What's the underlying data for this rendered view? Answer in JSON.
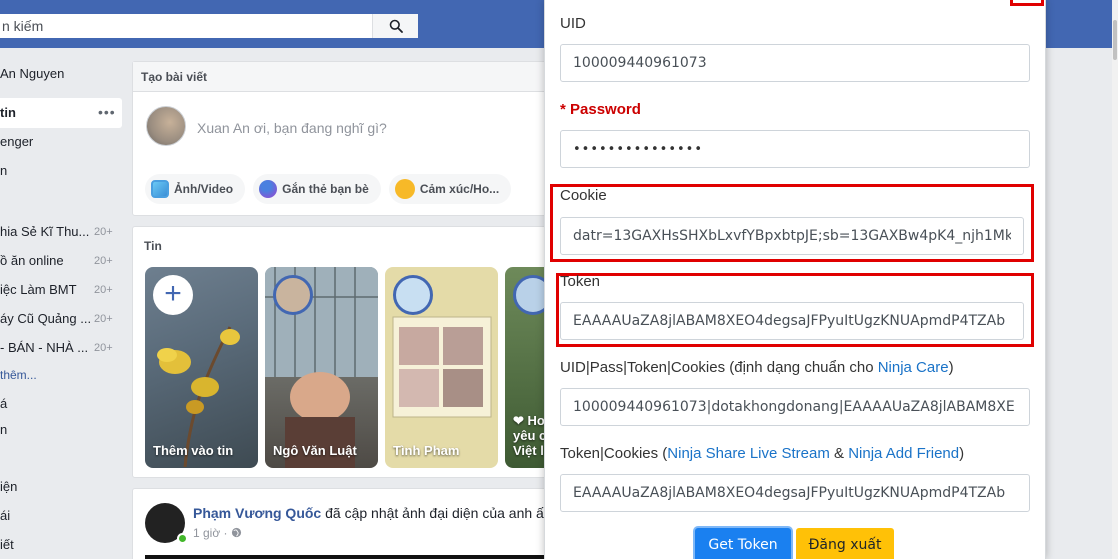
{
  "topbar": {
    "search_placeholder": "n kiếm",
    "search_icon": "search-icon"
  },
  "sidebar": {
    "profile": "An Nguyen",
    "items": [
      {
        "label": "tin",
        "top": 0
      },
      {
        "label": "enger"
      },
      {
        "label": "n"
      },
      {
        "label": "hia Sẻ Kĩ Thu...",
        "count": "20+"
      },
      {
        "label": "ồ ăn online",
        "count": "20+"
      },
      {
        "label": "iệc Làm BMT",
        "count": "20+"
      },
      {
        "label": "áy Cũ Quảng ...",
        "count": "20+"
      },
      {
        "label": "- BÁN - NHÀ ...",
        "count": "20+"
      },
      {
        "label": "thêm..."
      },
      {
        "label": "á"
      },
      {
        "label": "n"
      },
      {
        "label": "iện"
      },
      {
        "label": "ái"
      },
      {
        "label": "iết"
      }
    ]
  },
  "composer": {
    "title": "Tạo bài viết",
    "placeholder": "Xuan An ơi, bạn đang nghĩ gì?",
    "actions": [
      "Ảnh/Video",
      "Gắn thẻ bạn bè",
      "Cảm xúc/Ho..."
    ]
  },
  "stories": {
    "title": "Tin",
    "items": [
      {
        "name": "Thêm vào tin"
      },
      {
        "name": "Ngô Văn Luật"
      },
      {
        "name": "Tình Pham"
      },
      {
        "name": "❤ Ho yêu c Việt l"
      }
    ]
  },
  "post": {
    "author": "Phạm Vương Quốc",
    "action": "đã cập nhật ảnh đại diện của anh ấ",
    "time": "1 giờ ·"
  },
  "popup": {
    "uid_label": "UID",
    "uid_value": "100009440961073",
    "password_label": "Password",
    "password_required": "*",
    "password_value": "•••••••••••••••",
    "cookie_label": "Cookie",
    "cookie_value": "datr=13GAXHsSHXbLxvfYBpxbtpJE;sb=13GAXBw4pK4_njh1Mkl",
    "token_label": "Token",
    "token_value": "EAAAAUaZA8jlABAM8XEO4degsaJFPyuItUgzKNUApmdP4TZAb",
    "combo1_label_prefix": "UID|Pass|Token|Cookies (định dạng chuẩn cho ",
    "combo1_link": "Ninja Care",
    "combo1_label_suffix": ")",
    "combo1_value": "100009440961073|dotakhongdonang|EAAAAUaZA8jlABAM8XE",
    "combo2_label_prefix": "Token|Cookies (",
    "combo2_link1": "Ninja Share Live Stream",
    "combo2_amp": " & ",
    "combo2_link2": "Ninja Add Friend",
    "combo2_label_suffix": ")",
    "combo2_value": "EAAAAUaZA8jlABAM8XEO4degsaJFPyuItUgzKNUApmdP4TZAb",
    "get_token_button": "Get Token",
    "logout_button": "Đăng xuất"
  },
  "colors": {
    "facebook_blue": "#4267b2",
    "highlight_red": "#e00000",
    "primary_button": "#1a80f0",
    "warning_button": "#ffc107"
  }
}
